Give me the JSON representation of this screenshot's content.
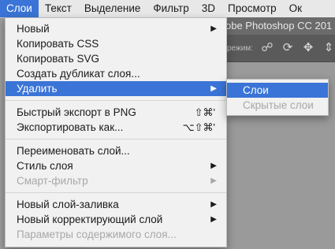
{
  "menubar": {
    "items": [
      {
        "label": "Слои",
        "active": true
      },
      {
        "label": "Текст"
      },
      {
        "label": "Выделение"
      },
      {
        "label": "Фильтр"
      },
      {
        "label": "3D"
      },
      {
        "label": "Просмотр"
      },
      {
        "label": "Ок"
      }
    ]
  },
  "app": {
    "title": "obe Photoshop CC 201",
    "opt_label": "режим:"
  },
  "menu": {
    "new": "Новый",
    "copy_css": "Копировать CSS",
    "copy_svg": "Копировать SVG",
    "duplicate": "Создать дубликат слоя...",
    "delete": "Удалить",
    "quick_export": "Быстрый экспорт в PNG",
    "quick_export_shortcut": "⇧⌘'",
    "export_as": "Экспортировать как...",
    "export_as_shortcut": "⌥⇧⌘'",
    "rename": "Переименовать слой...",
    "layer_style": "Стиль слоя",
    "smart_filter": "Смарт-фильтр",
    "new_fill": "Новый слой-заливка",
    "new_adjust": "Новый корректирующий слой",
    "content_params": "Параметры содержимого слоя..."
  },
  "submenu": {
    "layers": "Слои",
    "hidden_layers": "Скрытые слои"
  }
}
